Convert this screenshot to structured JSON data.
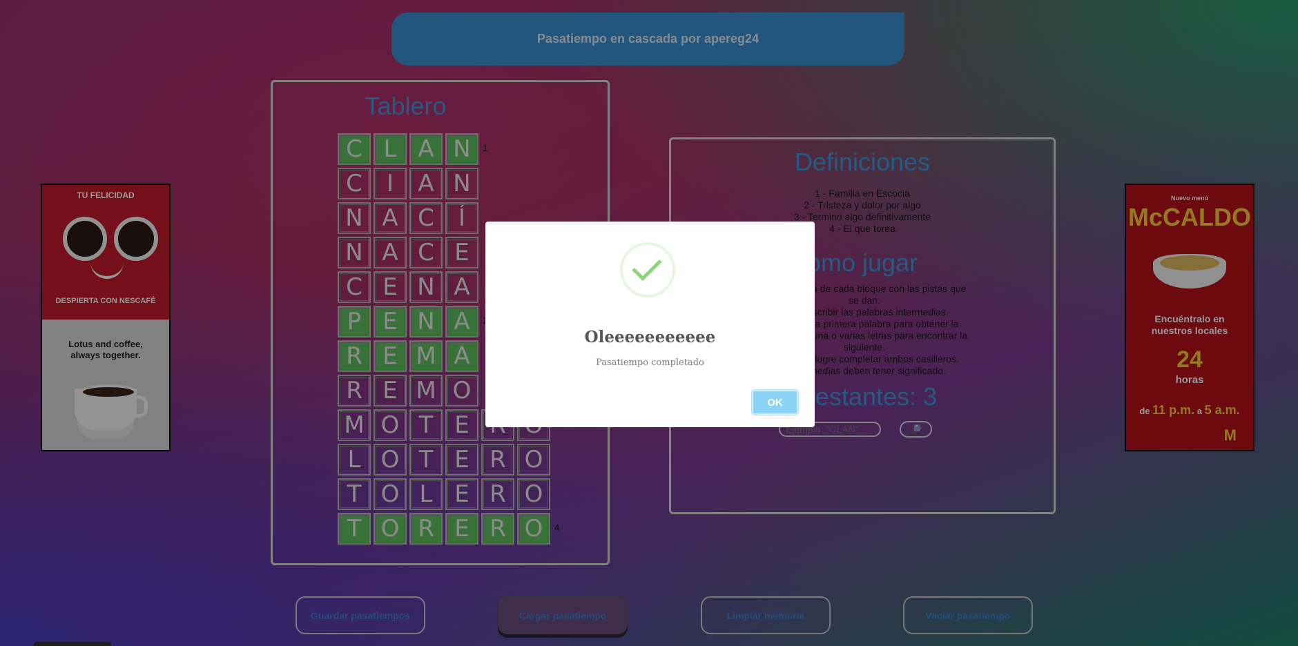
{
  "header": {
    "title": "Pasatiempo en cascada por apereg24"
  },
  "board": {
    "title": "Tablero",
    "rows": [
      {
        "letters": [
          "C",
          "L",
          "A",
          "N"
        ],
        "green": true,
        "num": "1"
      },
      {
        "letters": [
          "C",
          "I",
          "A",
          "N"
        ],
        "green": false,
        "num": ""
      },
      {
        "letters": [
          "N",
          "A",
          "C",
          "Í"
        ],
        "green": false,
        "num": ""
      },
      {
        "letters": [
          "N",
          "A",
          "C",
          "E"
        ],
        "green": false,
        "num": ""
      },
      {
        "letters": [
          "C",
          "E",
          "N",
          "A"
        ],
        "green": false,
        "num": ""
      },
      {
        "letters": [
          "P",
          "E",
          "N",
          "A"
        ],
        "green": true,
        "num": "2"
      },
      {
        "letters": [
          "R",
          "E",
          "M",
          "A"
        ],
        "green": true,
        "num": ""
      },
      {
        "letters": [
          "R",
          "E",
          "M",
          "O"
        ],
        "green": false,
        "num": ""
      },
      {
        "letters": [
          "M",
          "O",
          "T",
          "E",
          "R",
          "O"
        ],
        "green": false,
        "num": ""
      },
      {
        "letters": [
          "L",
          "O",
          "T",
          "E",
          "R",
          "O"
        ],
        "green": false,
        "num": ""
      },
      {
        "letters": [
          "T",
          "O",
          "L",
          "E",
          "R",
          "O"
        ],
        "green": false,
        "num": ""
      },
      {
        "letters": [
          "T",
          "O",
          "R",
          "E",
          "R",
          "O"
        ],
        "green": true,
        "num": "4"
      }
    ]
  },
  "definitions": {
    "title": "Definiciones",
    "items": [
      "1 - Familia en Escocia",
      "2 - Tristeza y dolor por algo",
      "3 - Termino algo definitivamente",
      "4 - El que torea"
    ]
  },
  "howto": {
    "title": "omo jugar",
    "lines": [
      "ra y la última de cada bloque con las pistas que",
      "se dan.",
      "e de describir las palabras intermedias.",
      "a letra de la primera palabra para obtener la",
      "el orden de una o varias letras para encontrar la",
      "siguiente.",
      "hasta que logre completar ambos casilleros.",
      "s intermedias deben tener significado."
    ]
  },
  "remaining": {
    "text": "s restantes: 3"
  },
  "guess": {
    "placeholder": "Ejemplo: \"CLAN\"",
    "search_icon": "magnifier-icon",
    "search_glyph": "🔎"
  },
  "bottom_buttons": {
    "save": "Guardar pasatiempos",
    "load": "Cargar pasatiempo",
    "clear": "Limpiar memoria",
    "empty": "Vaciar pasatiempo"
  },
  "ad_left": {
    "tag": "TU FELICIDAD",
    "slogan": "DESPIERTA CON NESCAFÉ",
    "line1": "Lotus and coffee,",
    "line2": "always together."
  },
  "ad_right": {
    "small": "Nuevo menú",
    "brand": "McCALDO",
    "find1": "Encuéntralo en",
    "find2": "nuestros locales",
    "hours": "24",
    "hours_unit": "horas",
    "range_from": "de",
    "range_start": "11 p.m.",
    "range_mid": "a",
    "range_end": "5 a.m.",
    "logo": "M"
  },
  "modal": {
    "icon": "check-icon",
    "title": "Oleeeeeeeeeee",
    "text": "Pasatiempo completado",
    "ok": "OK"
  },
  "colors": {
    "accent": "#3f96dc",
    "green": "#5fbf5f",
    "header": "#3b8fd0",
    "ok": "#8cd4f5"
  }
}
